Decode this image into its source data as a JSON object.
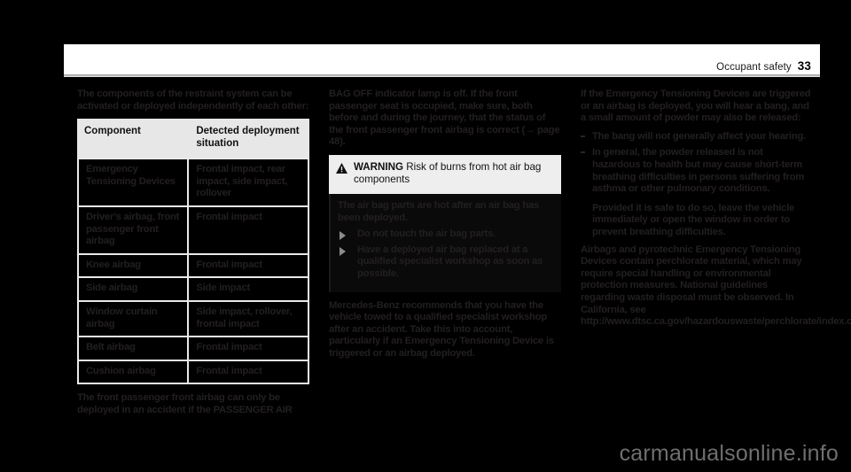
{
  "header": {
    "section_title": "Occupant safety",
    "page_number": "33"
  },
  "column_1": {
    "intro_paragraph": "The components of the restraint system can be activated or deployed independently of each other:",
    "table": {
      "headers": [
        "Component",
        "Detected deployment situation"
      ],
      "rows": [
        [
          "Emergency Tensioning Devices",
          "Frontal impact, rear impact, side impact, rollover"
        ],
        [
          "Driver's airbag, front passenger front airbag",
          "Frontal impact"
        ],
        [
          "Knee airbag",
          "Frontal impact"
        ],
        [
          "Side airbag",
          "Side impact"
        ],
        [
          "Window curtain airbag",
          "Side impact, rollover, frontal impact"
        ],
        [
          "Belt airbag",
          "Frontal impact"
        ],
        [
          "Cushion airbag",
          "Frontal impact"
        ]
      ]
    },
    "closing_paragraph": "The front passenger front airbag can only be deployed in an accident if the PASSENGER AIR"
  },
  "column_2": {
    "lead_paragraph": "BAG OFF indicator lamp is off. If the front passenger seat is occupied, make sure, both before and during the journey, that the status of the front passenger front airbag is correct (→ page 48).",
    "warning": {
      "icon": "warning-triangle-icon",
      "label": "WARNING",
      "title": "Risk of burns from hot air bag components",
      "lead": "The air bag parts are hot after an air bag has been deployed.",
      "bullets": [
        "Do not touch the air bag parts.",
        "Have a deployed air bag replaced at a qualified specialist workshop as soon as possible."
      ]
    },
    "closing_paragraph": "Mercedes-Benz recommends that you have the vehicle towed to a qualified specialist workshop after an accident. Take this into account, particularly if an Emergency Tensioning Device is triggered or an airbag deployed."
  },
  "column_3": {
    "lead_paragraph": "If the Emergency Tensioning Devices are triggered or an airbag is deployed, you will hear a bang, and a small amount of powder may also be released:",
    "bullets": [
      "The bang will not generally affect your hearing.",
      "In general, the powder released is not hazardous to health but may cause short-term breathing difficulties in persons suffering from asthma or other pulmonary conditions."
    ],
    "sub_paragraph": "Provided it is safe to do so, leave the vehicle immediately or open the window in order to prevent breathing difficulties.",
    "closing_paragraph": "Airbags and pyrotechnic Emergency Tensioning Devices contain perchlorate material, which may require special handling or environmental protection measures. National guidelines regarding waste disposal must be observed. In California, see http://www.dtsc.ca.gov/hazardouswaste/perchlorate/index.cfm."
  },
  "watermark": {
    "text": "carmanualsonline.info"
  },
  "colors": {
    "page_background": "#000000",
    "header_band": "#ffffff",
    "table_header_background": "#e7e7e7",
    "table_border": "#e9e9e9",
    "warning_header_background": "#eeeeee",
    "obscured_text": "#231f20",
    "watermark_text": "#6f6f6f"
  }
}
